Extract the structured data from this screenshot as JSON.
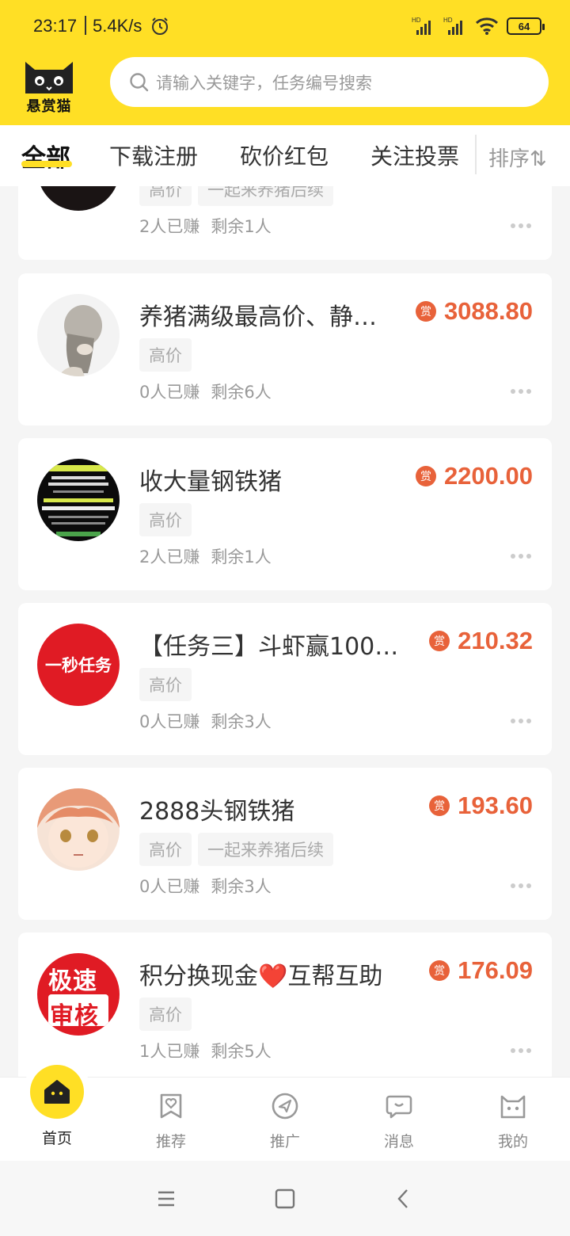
{
  "status_bar": {
    "time": "23:17",
    "speed": "5.4K/s",
    "battery": "64",
    "signal1": "HD",
    "signal2": "HD"
  },
  "header": {
    "brand": "悬赏猫",
    "search_placeholder": "请输入关键字，任务编号搜索"
  },
  "tabs": [
    {
      "label": "全部",
      "active": true
    },
    {
      "label": "下载注册",
      "active": false
    },
    {
      "label": "砍价红包",
      "active": false
    },
    {
      "label": "关注投票",
      "active": false
    }
  ],
  "sort_label": "排序⇅",
  "reward_badge": "赏",
  "tasks": [
    {
      "title": "",
      "amount": "",
      "tags": [
        "高价",
        "一起来养猪后续"
      ],
      "earned": "2人已赚",
      "remaining": "剩余1人",
      "avatar": "dark-avatar"
    },
    {
      "title": "养猪满级最高价、静…",
      "amount": "3088.80",
      "tags": [
        "高价"
      ],
      "earned": "0人已赚",
      "remaining": "剩余6人",
      "avatar": "girl-sketch-avatar"
    },
    {
      "title": "收大量钢铁猪",
      "amount": "2200.00",
      "tags": [
        "高价"
      ],
      "earned": "2人已赚",
      "remaining": "剩余1人",
      "avatar": "text-poster-avatar"
    },
    {
      "title": "【任务三】斗虾赢100…",
      "amount": "210.32",
      "tags": [
        "高价"
      ],
      "earned": "0人已赚",
      "remaining": "剩余3人",
      "avatar": "red-task-avatar",
      "avatar_text": "一秒任务"
    },
    {
      "title": "2888头钢铁猪",
      "amount": "193.60",
      "tags": [
        "高价",
        "一起来养猪后续"
      ],
      "earned": "0人已赚",
      "remaining": "剩余3人",
      "avatar": "anime-avatar"
    },
    {
      "title": "积分换现金❤️互帮互助",
      "amount": "176.09",
      "tags": [
        "高价"
      ],
      "earned": "1人已赚",
      "remaining": "剩余5人",
      "avatar": "red-review-avatar",
      "avatar_text_1": "极速",
      "avatar_text_2": "审核"
    }
  ],
  "bottom_nav": [
    {
      "label": "首页",
      "icon": "home-icon",
      "active": true
    },
    {
      "label": "推荐",
      "icon": "recommend-icon",
      "active": false
    },
    {
      "label": "推广",
      "icon": "promote-icon",
      "active": false
    },
    {
      "label": "消息",
      "icon": "message-icon",
      "active": false
    },
    {
      "label": "我的",
      "icon": "profile-cat-icon",
      "active": false
    }
  ],
  "colors": {
    "accent_yellow": "#ffdf25",
    "reward_orange": "#e8623a"
  }
}
